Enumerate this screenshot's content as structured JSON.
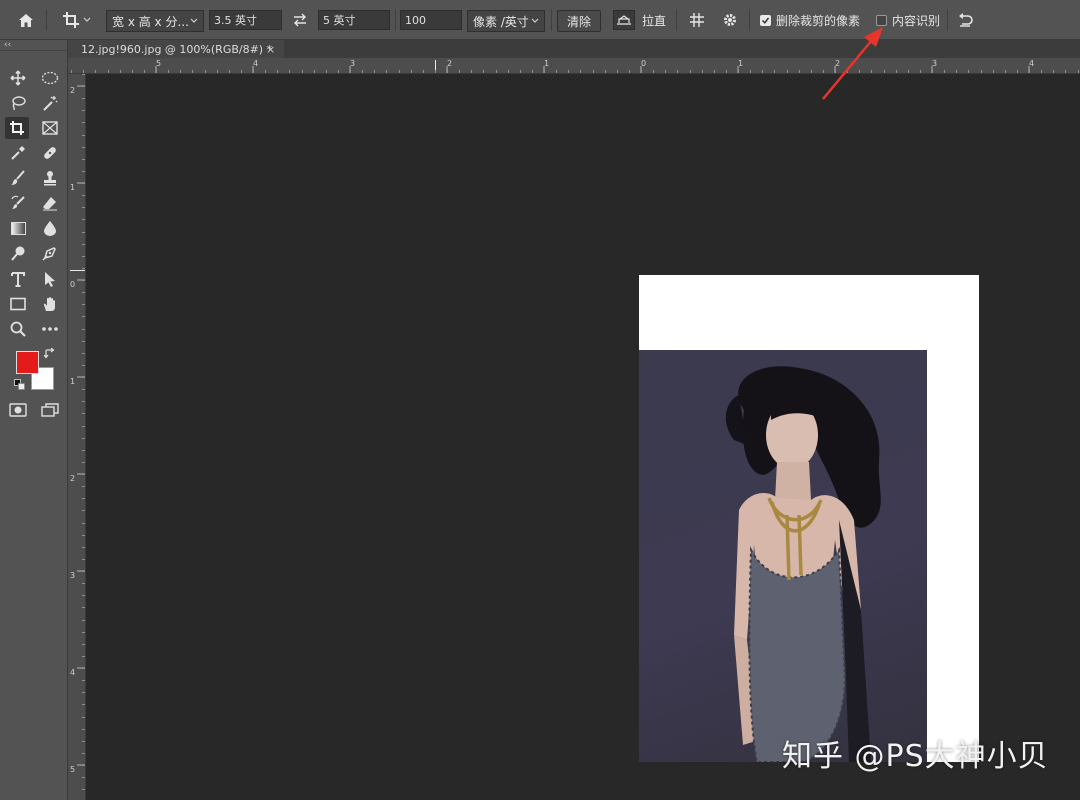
{
  "optionsbar": {
    "ratio_preset": "宽 x 高 x 分...",
    "width_value": "3.5 英寸",
    "height_value": "5 英寸",
    "resolution_value": "100",
    "resolution_unit": "像素 /英寸",
    "clear_label": "清除",
    "straighten_label": "拉直",
    "delete_cropped_label": "删除裁剪的像素",
    "delete_cropped_checked": true,
    "content_aware_label": "内容识别",
    "content_aware_checked": false
  },
  "document": {
    "tab_title": "12.jpg!960.jpg @ 100%(RGB/8#) *",
    "close_glyph": "×"
  },
  "toolbox": {
    "collapse_glyph": "‹‹",
    "foreground_color": "#e31b1b",
    "background_color": "#ffffff"
  },
  "rulers": {
    "horizontal": [
      "5",
      "4",
      "3",
      "2",
      "1",
      "0",
      "1",
      "2",
      "3",
      "4"
    ],
    "vertical": [
      "2",
      "1",
      "0",
      "1",
      "2",
      "3",
      "4",
      "5"
    ]
  },
  "annotation": {
    "arrow_color": "#e8352c"
  },
  "watermark": "知乎 @PS大神小贝"
}
